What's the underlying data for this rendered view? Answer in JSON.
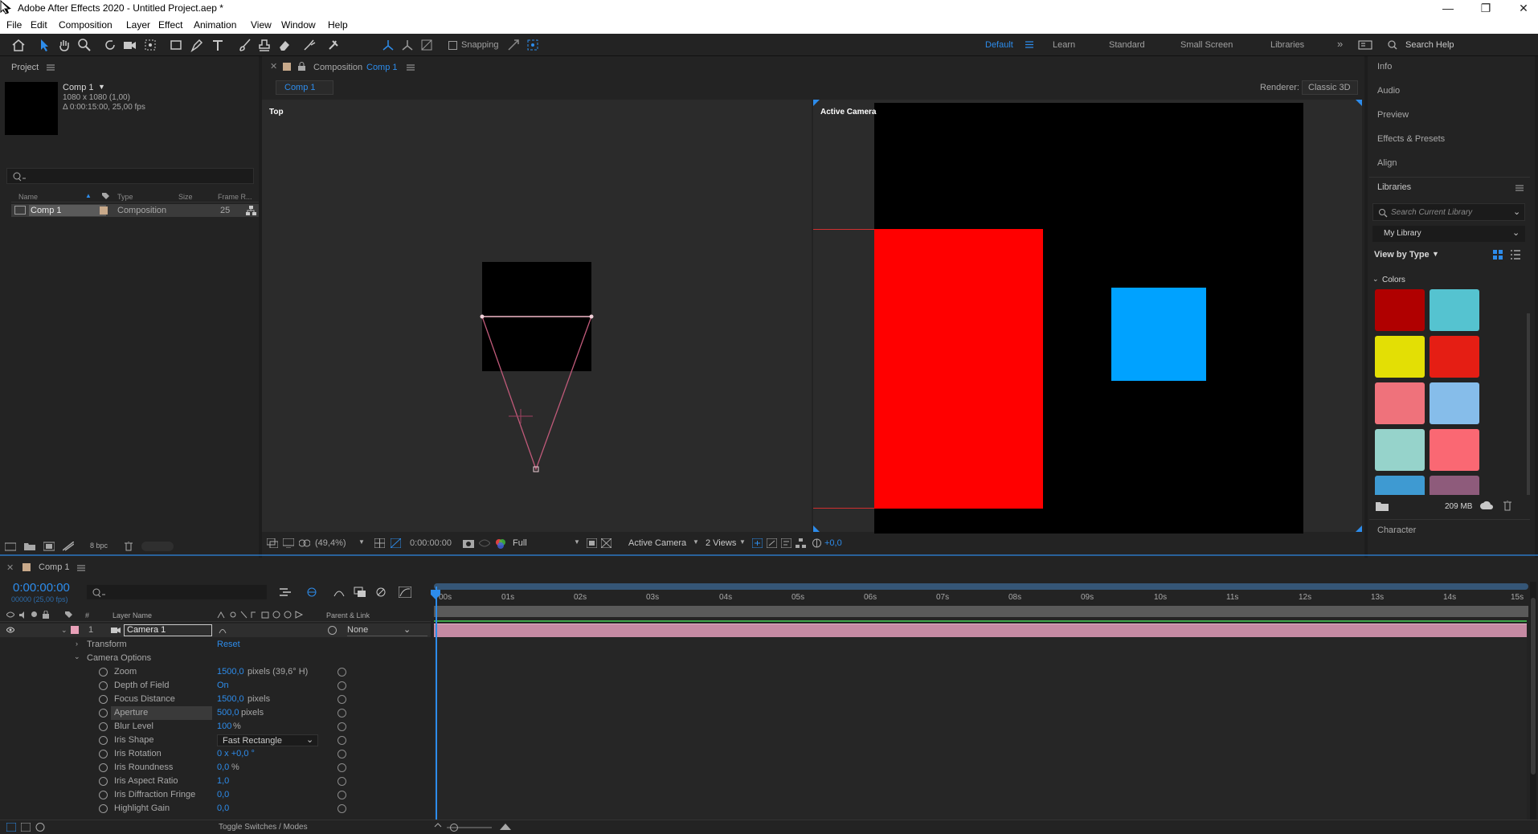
{
  "app": {
    "title": "Adobe After Effects 2020 - Untitled Project.aep *",
    "window_controls": [
      "—",
      "❐",
      "✕"
    ]
  },
  "menu": [
    "File",
    "Edit",
    "Composition",
    "Layer",
    "Effect",
    "Animation",
    "View",
    "Window",
    "Help"
  ],
  "toolbar": {
    "snapping_label": "Snapping",
    "workspaces": [
      "Default",
      "Learn",
      "Standard",
      "Small Screen",
      "Libraries"
    ],
    "active_workspace": "Default",
    "search_placeholder": "Search Help"
  },
  "project": {
    "tab": "Project",
    "comp_name": "Comp 1",
    "comp_size": "1080 x 1080 (1,00)",
    "comp_duration": "Δ 0:00:15:00, 25,00 fps",
    "columns": [
      "Name",
      "Type",
      "Size",
      "Frame R..."
    ],
    "items": [
      {
        "name": "Comp 1",
        "type": "Composition",
        "frame_rate": "25"
      }
    ],
    "bpc": "8 bpc"
  },
  "composition": {
    "tab_prefix": "Composition",
    "tab_name": "Comp 1",
    "breadcrumb": "Comp 1",
    "renderer_label": "Renderer:",
    "renderer_value": "Classic 3D",
    "left_view_label": "Top",
    "right_view_label": "Active Camera",
    "footer": {
      "zoom": "(49,4%)",
      "timecode": "0:00:00:00",
      "resolution": "Full",
      "camera": "Active Camera",
      "views": "2 Views",
      "exposure": "+0,0"
    }
  },
  "right_panel": {
    "items": [
      "Info",
      "Audio",
      "Preview",
      "Effects & Presets",
      "Align"
    ],
    "libraries_title": "Libraries",
    "search_placeholder": "Search Current Library",
    "library_name": "My Library",
    "view_by": "View by Type",
    "colors_header": "Colors",
    "swatches": [
      "#b00000",
      "#55c3d0",
      "#e3df05",
      "#e51e14",
      "#ef727b",
      "#86bdea",
      "#96d3cb",
      "#fa6873",
      "#3e9ad2",
      "#8e5b7b"
    ],
    "storage": "209 MB",
    "character_label": "Character"
  },
  "timeline": {
    "tab": "Comp 1",
    "timecode": "0:00:00:00",
    "frame_info": "00000 (25,00 fps)",
    "columns": {
      "layer_name": "Layer Name",
      "parent": "Parent & Link"
    },
    "ruler": [
      "00s",
      "01s",
      "02s",
      "03s",
      "04s",
      "05s",
      "06s",
      "07s",
      "08s",
      "09s",
      "10s",
      "11s",
      "12s",
      "13s",
      "14s",
      "15s"
    ],
    "layer": {
      "number": "1",
      "name": "Camera 1",
      "parent": "None"
    },
    "transform": {
      "label": "Transform",
      "reset": "Reset"
    },
    "camera_options_label": "Camera Options",
    "properties": [
      {
        "label": "Zoom",
        "value": "1500,0",
        "unit": "pixels (39,6° H)"
      },
      {
        "label": "Depth of Field",
        "value": "On",
        "unit": ""
      },
      {
        "label": "Focus Distance",
        "value": "1500,0",
        "unit": "pixels"
      },
      {
        "label": "Aperture",
        "value": "500,0",
        "unit": "pixels"
      },
      {
        "label": "Blur Level",
        "value": "100",
        "unit": "%"
      },
      {
        "label": "Iris Shape",
        "value": "Fast Rectangle",
        "unit": ""
      },
      {
        "label": "Iris Rotation",
        "value": "0 x +0,0 °",
        "unit": ""
      },
      {
        "label": "Iris Roundness",
        "value": "0,0",
        "unit": "%"
      },
      {
        "label": "Iris Aspect Ratio",
        "value": "1,0",
        "unit": ""
      },
      {
        "label": "Iris Diffraction Fringe",
        "value": "0,0",
        "unit": ""
      },
      {
        "label": "Highlight Gain",
        "value": "0,0",
        "unit": ""
      }
    ],
    "toggle_label": "Toggle Switches / Modes"
  }
}
